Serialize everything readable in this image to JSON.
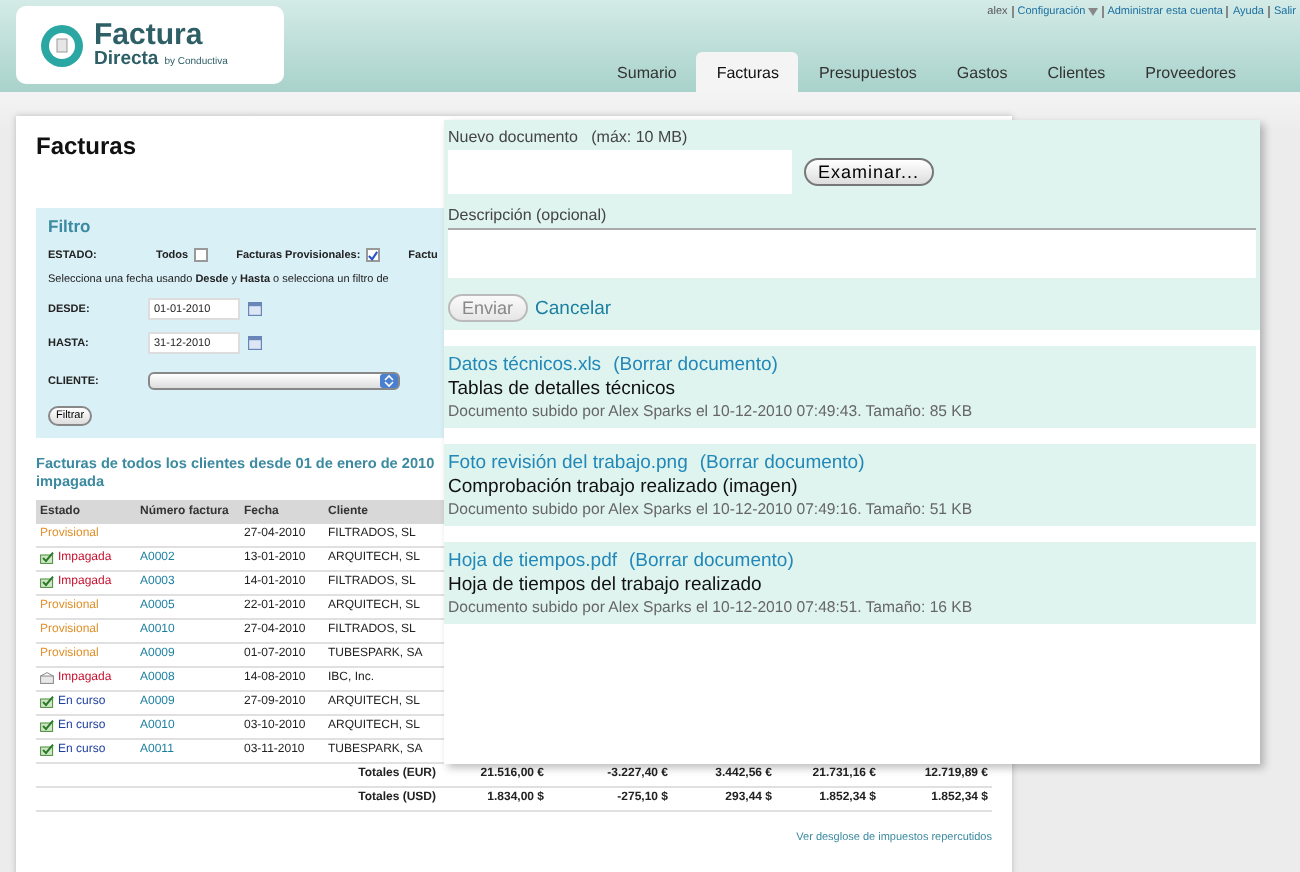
{
  "header": {
    "logo": {
      "title": "Factura",
      "subtitle": "Directa",
      "tagline": "by Conductiva"
    },
    "user_links": [
      {
        "label": "alex",
        "kind": "text"
      },
      {
        "label": "Configuración",
        "kind": "menu"
      },
      {
        "label": "Administrar esta cuenta",
        "kind": "link"
      },
      {
        "label": "Ayuda",
        "kind": "link"
      },
      {
        "label": "Salir",
        "kind": "link"
      }
    ],
    "tabs": [
      {
        "label": "Sumario",
        "selected": false
      },
      {
        "label": "Facturas",
        "selected": true
      },
      {
        "label": "Presupuestos",
        "selected": false
      },
      {
        "label": "Gastos",
        "selected": false
      },
      {
        "label": "Clientes",
        "selected": false
      },
      {
        "label": "Proveedores",
        "selected": false
      }
    ]
  },
  "page": {
    "title": "Facturas",
    "filter": {
      "title": "Filtro",
      "estado_label": "ESTADO:",
      "options": [
        {
          "label": "Todos",
          "checked": false
        },
        {
          "label": "Facturas Provisionales:",
          "checked": true
        }
      ],
      "cut_label": "Factu",
      "hint": "Selecciona una fecha usando **Desde** y **Hasta** o selecciona un filtro de",
      "dates": [
        {
          "label": "DESDE:",
          "value": "01-01-2010"
        },
        {
          "label": "HASTA:",
          "value": "31-12-2010"
        }
      ],
      "client_label": "CLIENTE:",
      "button": "Filtrar"
    },
    "list_title": "Facturas de todos los clientes desde 01 de enero de 2010 impagada",
    "table": {
      "columns": [
        "Estado",
        "Número factura",
        "Fecha",
        "Cliente"
      ],
      "rows": [
        {
          "status": "Provisional",
          "kind": "provisional",
          "date": "27-04-2010",
          "client": "FILTRADOS, SL"
        },
        {
          "status": "Impagada",
          "kind": "unpaidsent",
          "number": "A0002",
          "date": "13-01-2010",
          "client": "ARQUITECH, SL"
        },
        {
          "status": "Impagada",
          "kind": "unpaidsent",
          "number": "A0003",
          "date": "14-01-2010",
          "client": "FILTRADOS, SL"
        },
        {
          "status": "Provisional",
          "kind": "provisional",
          "number": "A0005",
          "date": "22-01-2010",
          "client": "ARQUITECH, SL"
        },
        {
          "status": "Provisional",
          "kind": "provisional",
          "number": "A0010",
          "date": "27-04-2010",
          "client": "FILTRADOS, SL"
        },
        {
          "status": "Provisional",
          "kind": "provisional",
          "number": "A0009",
          "date": "01-07-2010",
          "client": "TUBESPARK, SA"
        },
        {
          "status": "Impagada",
          "kind": "unpaidpending",
          "number": "A0008",
          "date": "14-08-2010",
          "client": "IBC, Inc."
        },
        {
          "status": "En curso",
          "kind": "inprogress",
          "number": "A0009",
          "date": "27-09-2010",
          "client": "ARQUITECH, SL"
        },
        {
          "status": "En curso",
          "kind": "inprogress",
          "number": "A0010",
          "date": "03-10-2010",
          "client": "ARQUITECH, SL"
        },
        {
          "status": "En curso",
          "kind": "inprogress",
          "number": "A0011",
          "date": "03-11-2010",
          "client": "TUBESPARK, SA"
        }
      ],
      "totals": [
        {
          "label": "Totales (EUR)",
          "values": [
            "21.516,00 €",
            "-3.227,40 €",
            "3.442,56 €",
            "21.731,16 €",
            "12.719,89 €"
          ]
        },
        {
          "label": "Totales (USD)",
          "values": [
            "1.834,00 $",
            "-275,10 $",
            "293,44 $",
            "1.852,34 $",
            "1.852,34 $"
          ]
        }
      ]
    },
    "tax_link": "Ver desglose de impuestos repercutidos"
  },
  "upload_panel": {
    "label": "Nuevo documento",
    "limit": "(máx: 10 MB)",
    "browse_button": "Examinar...",
    "description_label": "Descripción (opcional)",
    "submit": {
      "label": "Enviar",
      "disabled": true
    },
    "cancel": "Cancelar",
    "documents": [
      {
        "name": "Datos técnicos.xls",
        "delete": "(Borrar documento)",
        "description": "Tablas de detalles técnicos",
        "meta": "Documento subido por Alex Sparks el 10-12-2010 07:49:43. Tamaño: 85 KB"
      },
      {
        "name": "Foto revisión del trabajo.png",
        "delete": "(Borrar documento)",
        "description": "Comprobación trabajo realizado (imagen)",
        "meta": "Documento subido por Alex Sparks el 10-12-2010 07:49:16. Tamaño: 51 KB"
      },
      {
        "name": "Hoja de tiempos.pdf",
        "delete": "(Borrar documento)",
        "description": "Hoja de tiempos del trabajo realizado",
        "meta": "Documento subido por Alex Sparks el 10-12-2010 07:48:51. Tamaño: 16 KB"
      }
    ]
  }
}
